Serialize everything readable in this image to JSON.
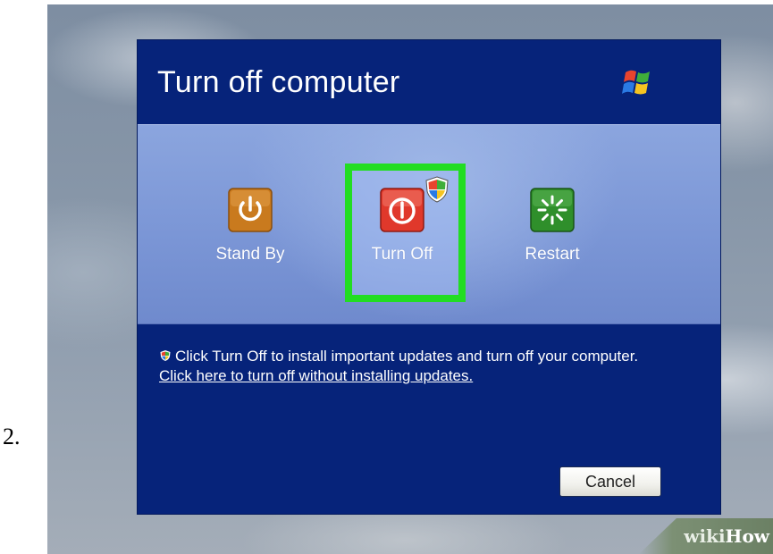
{
  "step": {
    "number": "2."
  },
  "dialog": {
    "title": "Turn off computer",
    "logo_icon": "windows-flag-icon",
    "options": [
      {
        "label": "Stand By",
        "icon": "power-icon",
        "color": "#c97a1e"
      },
      {
        "label": "Turn Off",
        "icon": "power-icon",
        "color": "#e0382b",
        "badge": "security-shield-icon",
        "highlighted": true,
        "highlight_color": "#22dd22"
      },
      {
        "label": "Restart",
        "icon": "restart-icon",
        "color": "#2f8f2b"
      }
    ],
    "message": {
      "text": "Click Turn Off to install important updates and turn off your computer.",
      "link": "Click here to turn off without installing updates."
    },
    "cancel_label": "Cancel"
  },
  "watermark": {
    "prefix": "wiki",
    "suffix": "How"
  },
  "colors": {
    "dialog_background": "#06237a",
    "panel_background": "#7b96d6",
    "highlight": "#22dd22"
  }
}
